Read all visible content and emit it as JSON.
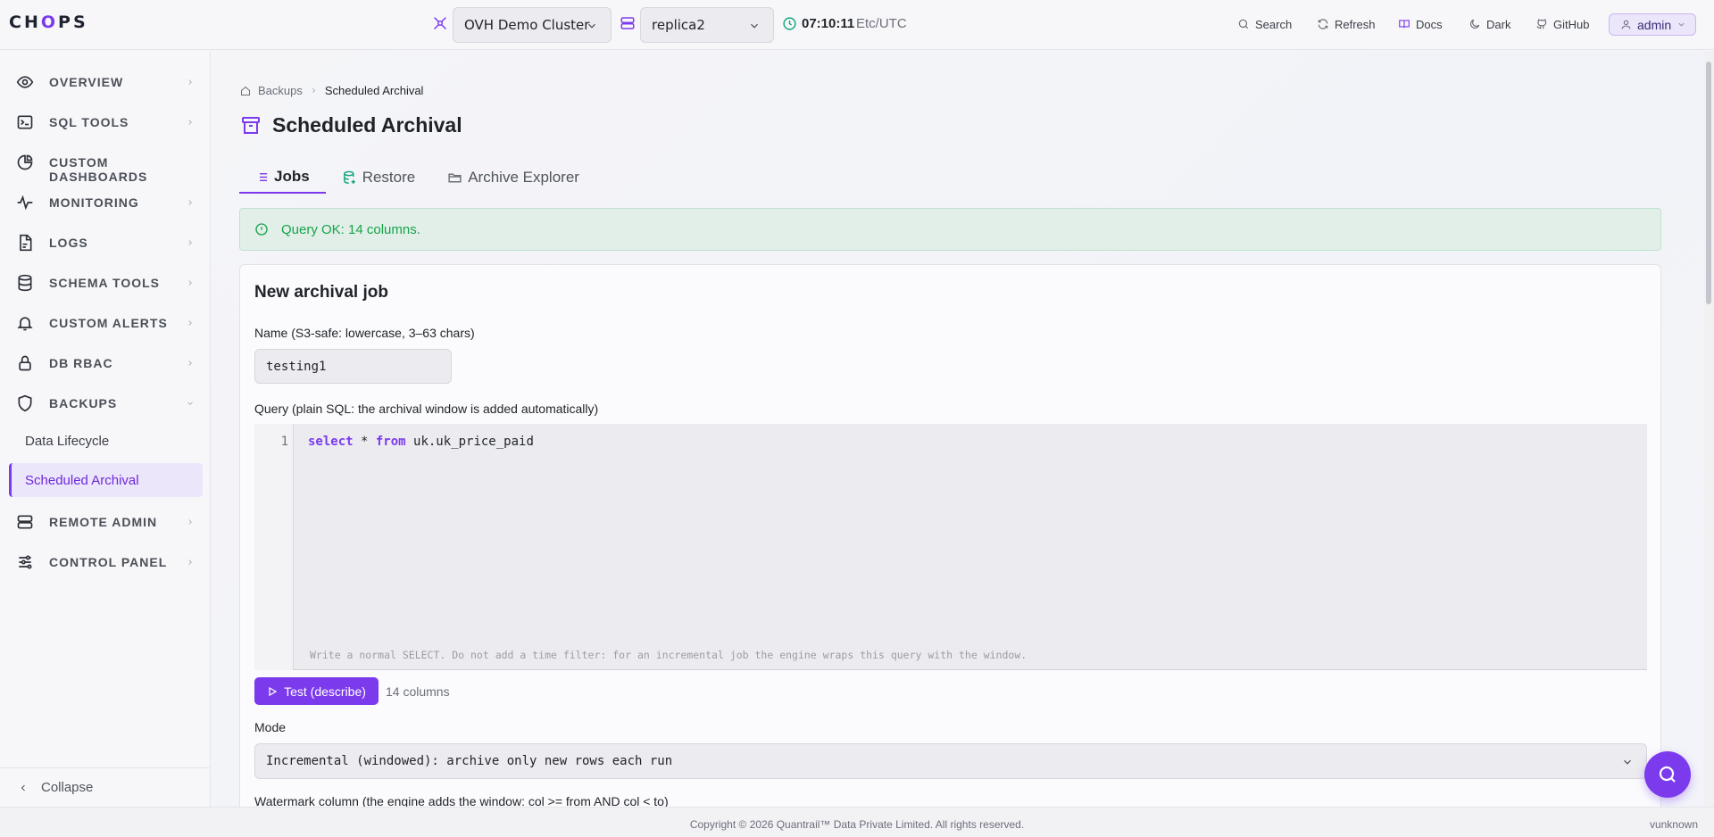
{
  "app": {
    "logo_prefix": "CH",
    "logo_accent": "O",
    "logo_suffix": "PS",
    "accent_color": "#7c3aed"
  },
  "header": {
    "cluster": "OVH Demo Cluster",
    "replica": "replica2",
    "time": "07:10:11",
    "timezone": "Etc/UTC",
    "search": "Search",
    "refresh": "Refresh",
    "docs": "Docs",
    "dark": "Dark",
    "github": "GitHub",
    "user": "admin"
  },
  "sidebar": {
    "items": [
      {
        "label": "OVERVIEW",
        "icon": "eye-icon"
      },
      {
        "label": "SQL TOOLS",
        "icon": "terminal-icon"
      },
      {
        "label": "CUSTOM DASHBOARDS",
        "icon": "pie-chart-icon"
      },
      {
        "label": "MONITORING",
        "icon": "activity-icon"
      },
      {
        "label": "LOGS",
        "icon": "file-icon"
      },
      {
        "label": "SCHEMA TOOLS",
        "icon": "database-icon"
      },
      {
        "label": "CUSTOM ALERTS",
        "icon": "bell-icon"
      },
      {
        "label": "DB RBAC",
        "icon": "lock-icon"
      },
      {
        "label": "BACKUPS",
        "icon": "shield-icon"
      },
      {
        "label": "REMOTE ADMIN",
        "icon": "server-icon"
      },
      {
        "label": "CONTROL PANEL",
        "icon": "sliders-icon"
      }
    ],
    "backups_sub": [
      "Data Lifecycle",
      "Scheduled Archival"
    ],
    "collapse": "Collapse"
  },
  "breadcrumb": {
    "root": "Backups",
    "current": "Scheduled Archival"
  },
  "page": {
    "title": "Scheduled Archival"
  },
  "tabs": [
    {
      "label": "Jobs",
      "active": true
    },
    {
      "label": "Restore",
      "active": false
    },
    {
      "label": "Archive Explorer",
      "active": false
    }
  ],
  "alert": {
    "message": "Query OK: 14 columns."
  },
  "form": {
    "title": "New archival job",
    "name_label": "Name (S3-safe: lowercase, 3–63 chars)",
    "name_value": "testing1",
    "query_label": "Query (plain SQL: the archival window is added automatically)",
    "query_line_number": "1",
    "query_kw_select": "select",
    "query_star": " * ",
    "query_kw_from": "from",
    "query_table": " uk.uk_price_paid",
    "query_hint": "Write a normal SELECT. Do not add a time filter: for an incremental job the engine wraps this query with the window.",
    "test_button": "Test (describe)",
    "column_count": "14 columns",
    "mode_label": "Mode",
    "mode_value": "Incremental (windowed): archive only new rows each run",
    "watermark_label": "Watermark column (the engine adds the window: col >= from AND col < to)"
  },
  "footer": {
    "copyright": "Copyright © 2026 Quantrail™ Data Private Limited. All rights reserved.",
    "version": "vunknown"
  }
}
